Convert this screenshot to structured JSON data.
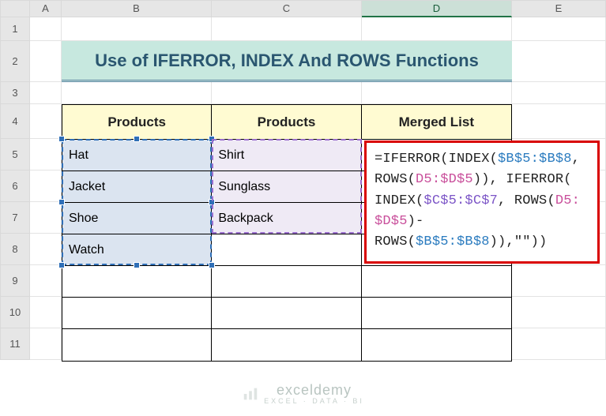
{
  "columns": [
    "A",
    "B",
    "C",
    "D",
    "E"
  ],
  "rows": [
    "1",
    "2",
    "3",
    "4",
    "5",
    "6",
    "7",
    "8",
    "9",
    "10",
    "11"
  ],
  "selected_column": "D",
  "title": "Use of IFERROR, INDEX And ROWS Functions",
  "headers": {
    "B": "Products",
    "C": "Products",
    "D": "Merged List"
  },
  "data": {
    "B": [
      "Hat",
      "Jacket",
      "Shoe",
      "Watch",
      "",
      "",
      ""
    ],
    "C": [
      "Shirt",
      "Sunglass",
      "Backpack",
      "",
      "",
      "",
      ""
    ],
    "D": [
      "",
      "",
      "",
      "",
      "",
      "",
      ""
    ]
  },
  "formula_parts": [
    {
      "t": "=IFERROR(INDEX(",
      "c": ""
    },
    {
      "t": "$B$5:$B$8",
      "c": "blue"
    },
    {
      "t": ",",
      "c": ""
    },
    {
      "t": "\n",
      "c": "br"
    },
    {
      "t": "ROWS(",
      "c": ""
    },
    {
      "t": "D5:$D$5",
      "c": "pink"
    },
    {
      "t": ")), IFERROR(",
      "c": ""
    },
    {
      "t": "\n",
      "c": "br"
    },
    {
      "t": "INDEX(",
      "c": ""
    },
    {
      "t": "$C$5:$C$7",
      "c": "purple"
    },
    {
      "t": ", ROWS(",
      "c": ""
    },
    {
      "t": "D5:",
      "c": "pink"
    },
    {
      "t": "\n",
      "c": "br"
    },
    {
      "t": "$D$5",
      "c": "pink"
    },
    {
      "t": ")-ROWS(",
      "c": ""
    },
    {
      "t": "$B$5:$B$8",
      "c": "blue"
    },
    {
      "t": ")),\"\"))",
      "c": ""
    }
  ],
  "watermark": {
    "brand": "exceldemy",
    "sub": "EXCEL · DATA · BI"
  },
  "chart_data": {
    "type": "table",
    "title": "Use of IFERROR, INDEX And ROWS Functions",
    "columns": [
      "Products",
      "Products",
      "Merged List"
    ],
    "rows": [
      [
        "Hat",
        "Shirt",
        ""
      ],
      [
        "Jacket",
        "Sunglass",
        ""
      ],
      [
        "Shoe",
        "Backpack",
        ""
      ],
      [
        "Watch",
        "",
        ""
      ],
      [
        "",
        "",
        ""
      ],
      [
        "",
        "",
        ""
      ],
      [
        "",
        "",
        ""
      ]
    ],
    "formula_in_D5": "=IFERROR(INDEX($B$5:$B$8,ROWS(D5:$D$5)), IFERROR(INDEX($C$5:$C$7, ROWS(D5:$D$5)-ROWS($B$5:$B$8)),\"\"))"
  }
}
